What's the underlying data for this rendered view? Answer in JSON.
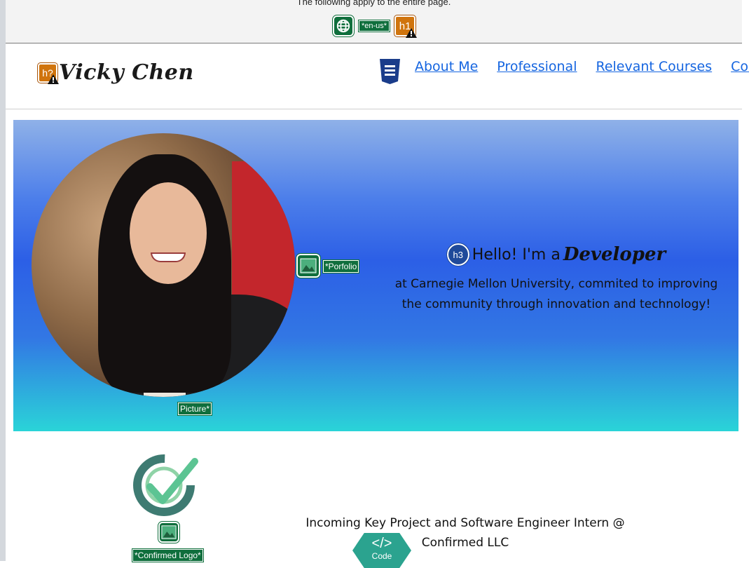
{
  "a11y_overlay": {
    "note": "The following apply to the entire page.",
    "lang_tag": "*en-us*",
    "heading_badge": "h1",
    "logo_heading_badge": "h?",
    "hero_heading_badge": "h3",
    "portfolio_image_label": "*Porfolio",
    "picture_label": "Picture*",
    "logo_image_label": "*Confirmed Logo*",
    "code_badge_label": "Code",
    "code_badge_symbol": "</>"
  },
  "header": {
    "logo_name": "Vicky Chen",
    "nav": [
      "About Me",
      "Professional",
      "Relevant Courses",
      "Conta"
    ]
  },
  "hero": {
    "greeting": "Hello! I'm a",
    "role": "Developer",
    "tagline_line1": "at Carnegie Mellon University, commited to improving",
    "tagline_line2": "the community through innovation and technology!"
  },
  "experience": {
    "line1": "Incoming Key Project and Software Engineer Intern @",
    "line2": "Confirmed LLC"
  },
  "colors": {
    "overlay_green": "#0f6e3c",
    "overlay_orange": "#d0740d",
    "link_blue": "#1565e0",
    "code_teal": "#2ba38f"
  }
}
